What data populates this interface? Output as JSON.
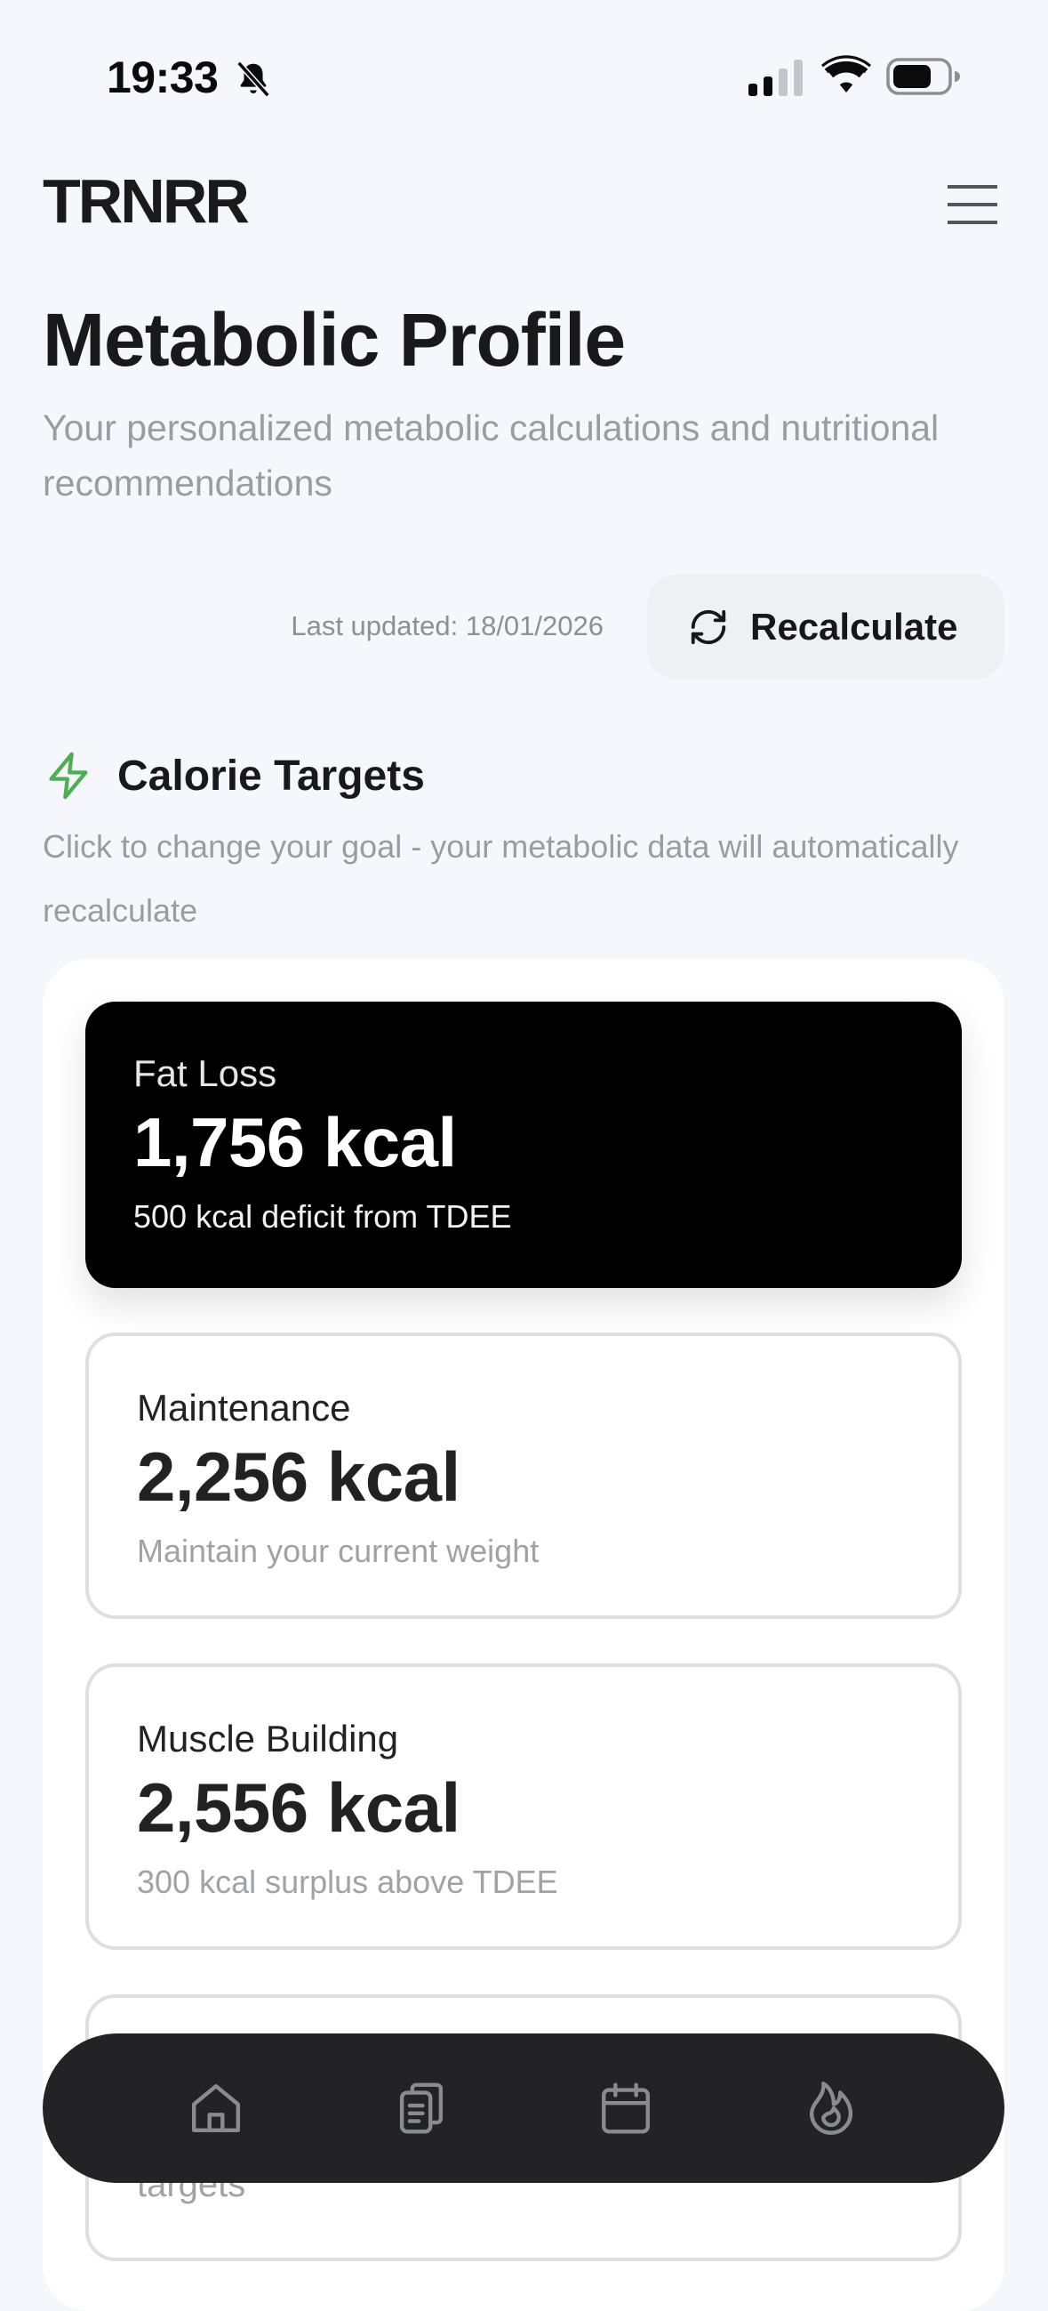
{
  "status_bar": {
    "time": "19:33"
  },
  "header": {
    "brand": "TRNRR"
  },
  "page": {
    "title": "Metabolic Profile",
    "subtitle": "Your personalized metabolic calculations and nutritional recommendations",
    "last_updated": "Last updated: 18/01/2026",
    "recalculate_label": "Recalculate"
  },
  "calorie_targets": {
    "title": "Calorie Targets",
    "description": "Click to change your goal - your metabolic data will automatically recalculate",
    "selected": "Fat Loss",
    "cards": [
      {
        "name": "Fat Loss",
        "kcal": "1,756 kcal",
        "description": "500 kcal deficit from TDEE"
      },
      {
        "name": "Maintenance",
        "kcal": "2,256 kcal",
        "description": "Maintain your current weight"
      },
      {
        "name": "Muscle Building",
        "kcal": "2,556 kcal",
        "description": "300 kcal surplus above TDEE"
      },
      {
        "partial_text": "targets"
      }
    ]
  },
  "bottom_nav": {
    "items": [
      {
        "icon": "home-icon"
      },
      {
        "icon": "clipboard-icon"
      },
      {
        "icon": "calendar-icon"
      },
      {
        "icon": "flame-icon"
      }
    ]
  },
  "colors": {
    "accent_green": "#4caf50",
    "selected_card": "#000000",
    "nav_background": "#232325"
  }
}
